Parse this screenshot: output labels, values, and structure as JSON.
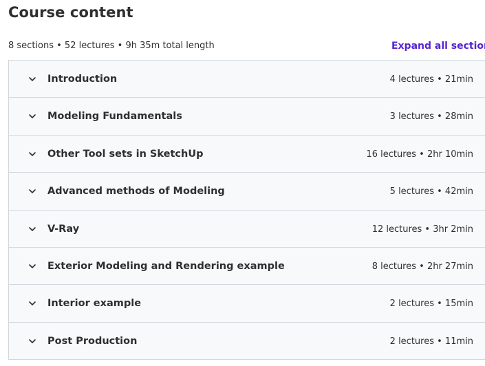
{
  "header": {
    "title": "Course content",
    "summary": "8 sections • 52 lectures • 9h 35m total length",
    "expand_all_label": "Expand all section"
  },
  "sections": [
    {
      "title": "Introduction",
      "meta": "4 lectures • 21min"
    },
    {
      "title": "Modeling Fundamentals",
      "meta": "3 lectures • 28min"
    },
    {
      "title": "Other Tool sets in SketchUp",
      "meta": "16 lectures • 2hr 10min"
    },
    {
      "title": "Advanced methods of Modeling",
      "meta": "5 lectures • 42min"
    },
    {
      "title": "V-Ray",
      "meta": "12 lectures • 3hr 2min"
    },
    {
      "title": "Exterior Modeling and Rendering example",
      "meta": "8 lectures • 2hr 27min"
    },
    {
      "title": "Interior example",
      "meta": "2 lectures • 15min"
    },
    {
      "title": "Post Production",
      "meta": "2 lectures • 11min"
    }
  ],
  "icons": {
    "section_toggle": "chevron-down-icon"
  },
  "colors": {
    "accent": "#5624d0",
    "text": "#2d2f31",
    "section_bg": "#f7f9fa",
    "border": "#d1d7dc"
  }
}
